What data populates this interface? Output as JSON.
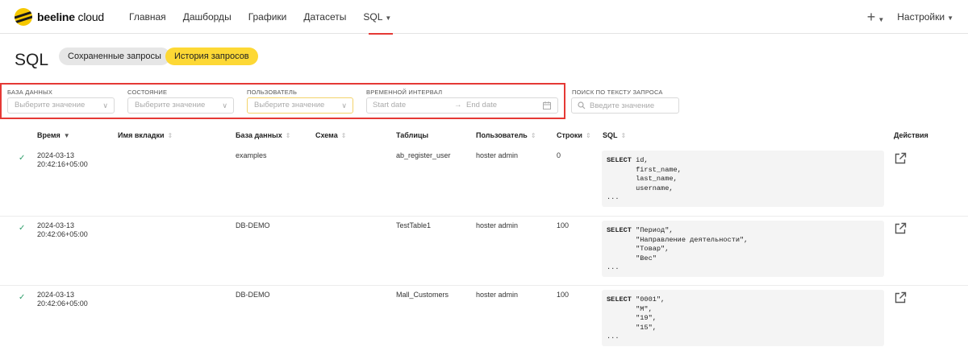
{
  "header": {
    "brand_bold": "beeline",
    "brand_light": " cloud",
    "nav": [
      "Главная",
      "Дашборды",
      "Графики",
      "Датасеты",
      "SQL"
    ],
    "add_label": "+",
    "settings_label": "Настройки"
  },
  "page": {
    "title": "SQL",
    "tabs": {
      "saved": "Сохраненные запросы",
      "history": "История запросов"
    }
  },
  "filters": {
    "database": {
      "label": "БАЗА ДАННЫХ",
      "placeholder": "Выберите значение"
    },
    "state": {
      "label": "СОСТОЯНИЕ",
      "placeholder": "Выберите значение"
    },
    "user": {
      "label": "ПОЛЬЗОВАТЕЛЬ",
      "placeholder": "Выберите значение"
    },
    "interval": {
      "label": "ВРЕМЕННОЙ ИНТЕРВАЛ",
      "start": "Start date",
      "end": "End date",
      "arrow": "→"
    },
    "search": {
      "label": "ПОИСК ПО ТЕКСТУ ЗАПРОСА",
      "placeholder": "Введите значение"
    }
  },
  "table": {
    "columns": [
      "Время",
      "Имя вкладки",
      "База данных",
      "Схема",
      "Таблицы",
      "Пользователь",
      "Строки",
      "SQL",
      "Действия"
    ],
    "rows": [
      {
        "date": "2024-03-13",
        "time": "20:42:16+05:00",
        "tab": "",
        "database": "examples",
        "schema": "",
        "tables": "ab_register_user",
        "user": "hoster admin",
        "rows": "0",
        "sql_kw": "SELECT",
        "sql_first": " id,",
        "sql_rest": "       first_name,\n       last_name,\n       username,\n...",
        "status": "✓"
      },
      {
        "date": "2024-03-13",
        "time": "20:42:06+05:00",
        "tab": "",
        "database": "DB-DEMO",
        "schema": "",
        "tables": "TestTable1",
        "user": "hoster admin",
        "rows": "100",
        "sql_kw": "SELECT",
        "sql_first": " \"Период\",",
        "sql_rest": "       \"Направление деятельности\",\n       \"Товар\",\n       \"Вес\"\n...",
        "status": "✓"
      },
      {
        "date": "2024-03-13",
        "time": "20:42:06+05:00",
        "tab": "",
        "database": "DB-DEMO",
        "schema": "",
        "tables": "Mall_Customers",
        "user": "hoster admin",
        "rows": "100",
        "sql_kw": "SELECT",
        "sql_first": " \"0001\",",
        "sql_rest": "       \"M\",\n       \"19\",\n       \"15\",\n...",
        "status": "✓"
      }
    ]
  },
  "colors": {
    "accent": "#fdd835",
    "highlight": "#e53935",
    "success": "#2e9e6b"
  },
  "icons": {
    "sort": "sort-icon",
    "action": "external-link-icon",
    "calendar": "calendar-icon",
    "search": "search-icon"
  }
}
